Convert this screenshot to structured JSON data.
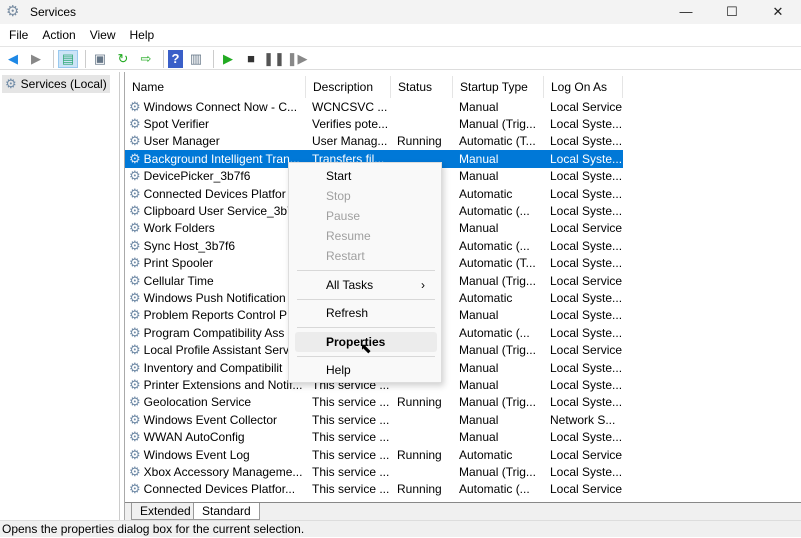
{
  "window": {
    "title": "Services",
    "minimize": "—",
    "maximize": "☐",
    "close": "✕"
  },
  "menubar": [
    "File",
    "Action",
    "View",
    "Help"
  ],
  "toolbar": {
    "icons": [
      "back-arrow-icon",
      "forward-arrow-icon",
      "show-hide-tree-icon",
      "properties-icon",
      "refresh-icon",
      "export-list-icon",
      "help-icon",
      "show-action-pane-icon",
      "start-service-icon",
      "stop-service-icon",
      "pause-service-icon",
      "resume-service-icon"
    ]
  },
  "tree": {
    "root": "Services (Local)"
  },
  "columns": [
    "Name",
    "Description",
    "Status",
    "Startup Type",
    "Log On As"
  ],
  "rows": [
    [
      "Windows Connect Now - C...",
      "WCNCSVC ...",
      "",
      "Manual",
      "Local Service"
    ],
    [
      "Spot Verifier",
      "Verifies pote...",
      "",
      "Manual (Trig...",
      "Local Syste..."
    ],
    [
      "User Manager",
      "User Manag...",
      "Running",
      "Automatic (T...",
      "Local Syste..."
    ],
    [
      "Background Intelligent Tran...",
      "Transfers fil...",
      "",
      "Manual",
      "Local Syste..."
    ],
    [
      "DevicePicker_3b7f6",
      "",
      "",
      "Manual",
      "Local Syste..."
    ],
    [
      "Connected Devices Platfor",
      "",
      "",
      "Automatic",
      "Local Syste..."
    ],
    [
      "Clipboard User Service_3b7",
      "",
      "",
      "Automatic (...",
      "Local Syste..."
    ],
    [
      "Work Folders",
      "",
      "",
      "Manual",
      "Local Service"
    ],
    [
      "Sync Host_3b7f6",
      "",
      "",
      "Automatic (...",
      "Local Syste..."
    ],
    [
      "Print Spooler",
      "",
      "",
      "Automatic (T...",
      "Local Syste..."
    ],
    [
      "Cellular Time",
      "",
      "",
      "Manual (Trig...",
      "Local Service"
    ],
    [
      "Windows Push Notification",
      "",
      "",
      "Automatic",
      "Local Syste..."
    ],
    [
      "Problem Reports Control P",
      "",
      "",
      "Manual",
      "Local Syste..."
    ],
    [
      "Program Compatibility Ass",
      "",
      "",
      "Automatic (...",
      "Local Syste..."
    ],
    [
      "Local Profile Assistant Serv",
      "",
      "",
      "Manual (Trig...",
      "Local Service"
    ],
    [
      "Inventory and Compatibilit",
      "",
      "",
      "Manual",
      "Local Syste..."
    ],
    [
      "Printer Extensions and Notif...",
      "This service ...",
      "",
      "Manual",
      "Local Syste..."
    ],
    [
      "Geolocation Service",
      "This service ...",
      "Running",
      "Manual (Trig...",
      "Local Syste..."
    ],
    [
      "Windows Event Collector",
      "This service ...",
      "",
      "Manual",
      "Network S..."
    ],
    [
      "WWAN AutoConfig",
      "This service ...",
      "",
      "Manual",
      "Local Syste..."
    ],
    [
      "Windows Event Log",
      "This service ...",
      "Running",
      "Automatic",
      "Local Service"
    ],
    [
      "Xbox Accessory Manageme...",
      "This service ...",
      "",
      "Manual (Trig...",
      "Local Syste..."
    ],
    [
      "Connected Devices Platfor...",
      "This service ...",
      "Running",
      "Automatic (...",
      "Local Service"
    ]
  ],
  "selected_row": 3,
  "context_menu": {
    "start": "Start",
    "stop": "Stop",
    "pause": "Pause",
    "resume": "Resume",
    "restart": "Restart",
    "all_tasks": "All Tasks",
    "all_tasks_arrow": "›",
    "refresh": "Refresh",
    "properties": "Properties",
    "help": "Help"
  },
  "tabs": {
    "extended": "Extended",
    "standard": "Standard"
  },
  "status_bar": "Opens the properties dialog box for the current selection.",
  "colors": {
    "selection": "#0078d7",
    "menu_bg": "#f9f9f9"
  }
}
